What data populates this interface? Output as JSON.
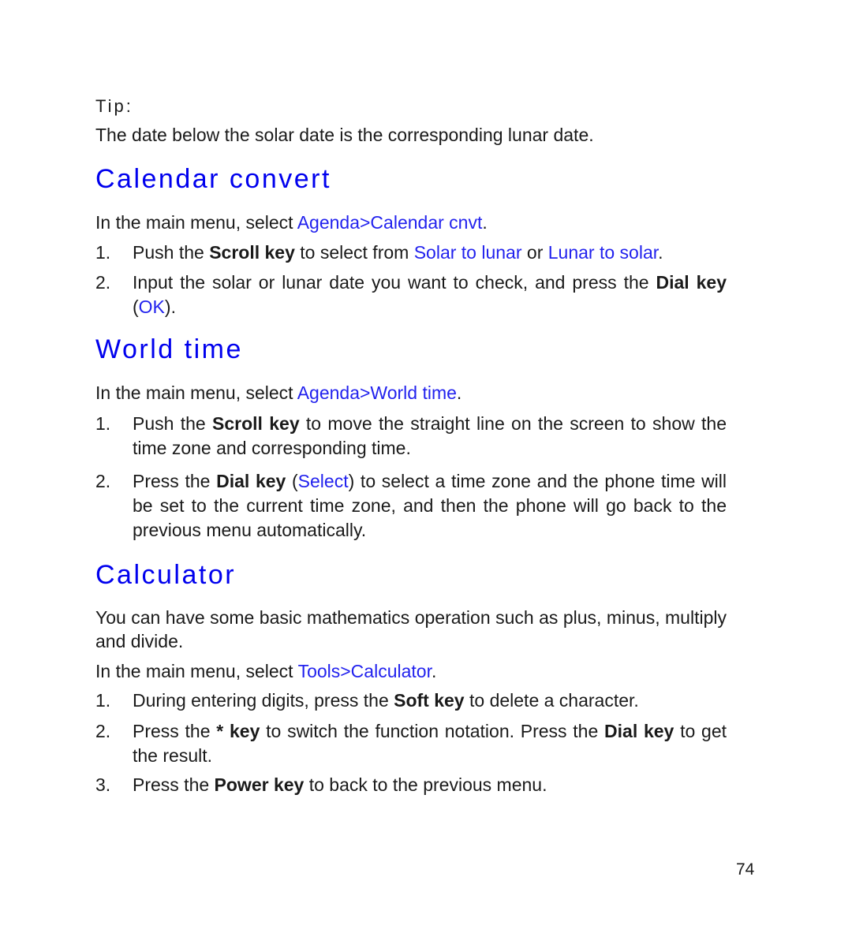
{
  "tip": {
    "label": "Tip:",
    "text": "The date below the solar date is the corresponding lunar date."
  },
  "sections": [
    {
      "title": "Calendar convert",
      "intro_prefix": "In the main menu, select ",
      "intro_link": "Agenda>Calendar cnvt",
      "intro_suffix": ".",
      "steps": [
        {
          "num": "1.",
          "a": "Push the ",
          "b1": "Scroll key",
          "c": " to select from ",
          "l1": "Solar to lunar",
          "d": " or ",
          "l2": "Lunar to solar",
          "e": "."
        },
        {
          "num": "2.",
          "a": "Input the solar or lunar date you want to check, and press the ",
          "b1": "Dial key",
          "c": " (",
          "l1": "OK",
          "d": ")."
        }
      ]
    },
    {
      "title": "World time",
      "intro_prefix": "In the main menu, select ",
      "intro_link": "Agenda>World time",
      "intro_suffix": ".",
      "steps": [
        {
          "num": "1.",
          "a": "Push the ",
          "b1": "Scroll key",
          "c": " to move the straight line on the screen to show the time zone and corresponding time."
        },
        {
          "num": "2.",
          "a": "Press the ",
          "b1": "Dial key",
          "c": " (",
          "l1": "Select",
          "d": ") to select a time zone and the phone time will be set to the current time zone, and then the phone will go back to the previous menu automatically."
        }
      ]
    },
    {
      "title": "Calculator",
      "description": "You can have some basic mathematics operation such as plus, minus, multiply and divide.",
      "intro_prefix": "In the main menu, select ",
      "intro_link": "Tools>Calculator",
      "intro_suffix": ".",
      "steps": [
        {
          "num": "1.",
          "a": "During entering digits, press the ",
          "b1": "Soft key",
          "c": " to delete a character."
        },
        {
          "num": "2.",
          "a": "Press the ",
          "b1": "* key",
          "c": " to switch the function notation. Press the ",
          "b2": "Dial key",
          "d": " to get the result."
        },
        {
          "num": "3.",
          "a": "Press the ",
          "b1": "Power key",
          "c": " to back to the previous menu."
        }
      ]
    }
  ],
  "page_number": "74",
  "colors": {
    "heading": "#0000ee",
    "link": "#2222ee",
    "text": "#1a1a1a"
  }
}
